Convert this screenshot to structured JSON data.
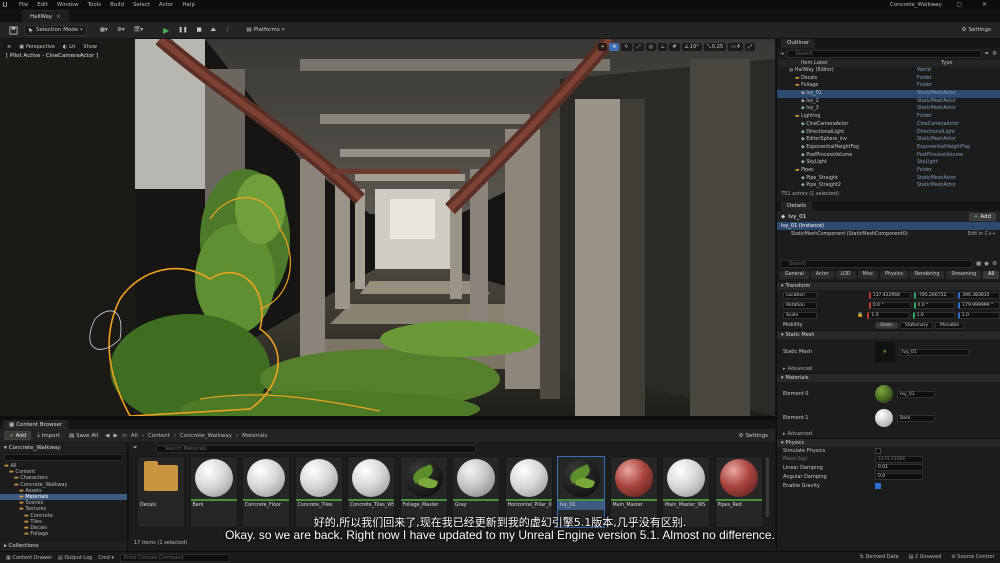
{
  "menubar": {
    "logo": "U",
    "items": [
      "File",
      "Edit",
      "Window",
      "Tools",
      "Build",
      "Select",
      "Actor",
      "Help"
    ],
    "project_title": "Concrete_Walkway",
    "window_buttons": "– ▢ ✕"
  },
  "tabbar": {
    "level_tab": "HallWay",
    "close": "×"
  },
  "toolbar": {
    "selection_mode": "Selection Mode",
    "platforms": "Platforms",
    "settings": "Settings"
  },
  "viewport": {
    "menu": "≡",
    "perspective": "Perspective",
    "lit": "Lit",
    "show": "Show",
    "pilot_status": "[ Pilot Active - CineCameraActor ]",
    "right_controls": {
      "angle": "10°",
      "scale": "0.25",
      "camera_speed": "4"
    }
  },
  "content_browser": {
    "tab": "Content Browser",
    "add": "Add",
    "import": "Import",
    "save_all": "Save All",
    "breadcrumb": [
      "All",
      "Content",
      "Concrete_Walkway",
      "Materials"
    ],
    "settings": "Settings",
    "source_header": "Concrete_Walkway",
    "search_placeholder": "Search Materials",
    "tree": [
      {
        "label": "All",
        "indent": 0,
        "selected": false
      },
      {
        "label": "Content",
        "indent": 1,
        "selected": false
      },
      {
        "label": "Characters",
        "indent": 2,
        "selected": false
      },
      {
        "label": "Concrete_Walkway",
        "indent": 2,
        "selected": false
      },
      {
        "label": "Assets",
        "indent": 3,
        "selected": false
      },
      {
        "label": "Materials",
        "indent": 3,
        "selected": true
      },
      {
        "label": "Scenes",
        "indent": 3,
        "selected": false
      },
      {
        "label": "Textures",
        "indent": 3,
        "selected": false
      },
      {
        "label": "Concrete",
        "indent": 4,
        "selected": false
      },
      {
        "label": "Tiles",
        "indent": 4,
        "selected": false
      },
      {
        "label": "Decals",
        "indent": 4,
        "selected": false
      },
      {
        "label": "Foliage",
        "indent": 4,
        "selected": false
      }
    ],
    "collections": "Collections",
    "assets": [
      {
        "label": "Decals",
        "thumb": "folder"
      },
      {
        "label": "Bark",
        "thumb": "white"
      },
      {
        "label": "Concrete_Floor",
        "thumb": "white"
      },
      {
        "label": "Concrete_Tiles",
        "thumb": "white"
      },
      {
        "label": "Concrete_Tiles_WS",
        "thumb": "white"
      },
      {
        "label": "Foliage_Master",
        "thumb": "leaf"
      },
      {
        "label": "Gray",
        "thumb": "gray"
      },
      {
        "label": "Horizontal_Pillar_01",
        "thumb": "white"
      },
      {
        "label": "Ivy_01",
        "thumb": "leaf"
      },
      {
        "label": "Main_Master",
        "thumb": "red"
      },
      {
        "label": "Main_Master_WS",
        "thumb": "white"
      },
      {
        "label": "Pipes_Red",
        "thumb": "red"
      }
    ],
    "item_count": "17 items (1 selected)"
  },
  "statusbar": {
    "content_drawer": "Content Drawer",
    "output_log": "Output Log",
    "cmd": "Cmd",
    "console_placeholder": "Enter Console Command",
    "derived_data": "Derived Data",
    "unsaved": "2 Unsaved",
    "source_control": "Source Control"
  },
  "outliner": {
    "tab": "Outliner",
    "search_placeholder": "Search",
    "col_label": "Item Label",
    "col_type": "Type",
    "rows": [
      {
        "label": "HallWay (Editor)",
        "type": "World",
        "indent": 0,
        "selected": false
      },
      {
        "label": "Decals",
        "type": "Folder",
        "indent": 1,
        "selected": false
      },
      {
        "label": "Foliage",
        "type": "Folder",
        "indent": 1,
        "selected": false
      },
      {
        "label": "Ivy_01",
        "type": "StaticMeshActor",
        "indent": 2,
        "selected": true
      },
      {
        "label": "Ivy_2",
        "type": "StaticMeshActor",
        "indent": 2,
        "selected": false
      },
      {
        "label": "Ivy_3",
        "type": "StaticMeshActor",
        "indent": 2,
        "selected": false
      },
      {
        "label": "Lighting",
        "type": "Folder",
        "indent": 1,
        "selected": false
      },
      {
        "label": "CineCameraActor",
        "type": "CineCameraActor",
        "indent": 2,
        "selected": false
      },
      {
        "label": "DirectionalLight",
        "type": "DirectionalLight",
        "indent": 2,
        "selected": false
      },
      {
        "label": "EditorSphere_inv",
        "type": "StaticMeshActor",
        "indent": 2,
        "selected": false
      },
      {
        "label": "ExponentialHeightFog",
        "type": "ExponentialHeightFog",
        "indent": 2,
        "selected": false
      },
      {
        "label": "PostProcessVolume",
        "type": "PostProcessVolume",
        "indent": 2,
        "selected": false
      },
      {
        "label": "SkyLight",
        "type": "SkyLight",
        "indent": 2,
        "selected": false
      },
      {
        "label": "Pipes",
        "type": "Folder",
        "indent": 1,
        "selected": false
      },
      {
        "label": "Pipe_Straight",
        "type": "StaticMeshActor",
        "indent": 2,
        "selected": false
      },
      {
        "label": "Pipe_Straight2",
        "type": "StaticMeshActor",
        "indent": 2,
        "selected": false
      }
    ],
    "footer": "751 actors (1 selected)"
  },
  "details": {
    "tab": "Details",
    "actor_name": "Ivy_01",
    "add": "Add",
    "instance": "Ivy_01 (Instance)",
    "component": "StaticMeshComponent (StaticMeshComponent0)",
    "edit_cpp": "Edit in C++",
    "search_placeholder": "Search",
    "filter_tabs": [
      "General",
      "Actor",
      "LOD",
      "Misc",
      "Physics",
      "Rendering",
      "Streaming",
      "All"
    ],
    "active_filter": "All",
    "transform": {
      "section": "Transform",
      "location_label": "Location",
      "location": [
        "137.422968",
        "-785.266752",
        "390.383835"
      ],
      "rotation_label": "Rotation",
      "rotation": [
        "0.0 °",
        "0.0 °",
        "179.999999 °"
      ],
      "scale_label": "Scale",
      "scale": [
        "1.0",
        "1.6",
        "1.0"
      ],
      "mobility_label": "Mobility",
      "mobility": [
        "Static",
        "Stationary",
        "Movable"
      ]
    },
    "static_mesh": {
      "section": "Static Mesh",
      "label": "Static Mesh",
      "value": "Ivy_01",
      "advanced": "Advanced"
    },
    "materials": {
      "section": "Materials",
      "element0_label": "Element 0",
      "element0": "Ivy_01",
      "element1_label": "Element 1",
      "element1": "Bark",
      "advanced": "Advanced"
    },
    "physics": {
      "section": "Physics",
      "simulate": "Simulate Physics",
      "mass": "Mass (kg)",
      "mass_value": "1474.01086",
      "linear_damping": "Linear Damping",
      "linear_value": "0.01",
      "angular_damping": "Angular Damping",
      "angular_value": "0.0",
      "gravity": "Enable Gravity"
    }
  },
  "subtitles": {
    "chinese": "好的,所以我们回来了,现在我已经更新到我的虚幻引擎5.1版本,几乎没有区别.",
    "english": "Okay. so we are back. Right now I have updated to my Unreal Engine version 5.1. Almost no difference."
  },
  "colors": {
    "accent": "#3d5a80",
    "selection_outline": "#f2a21f",
    "play_green": "#4caf50"
  }
}
